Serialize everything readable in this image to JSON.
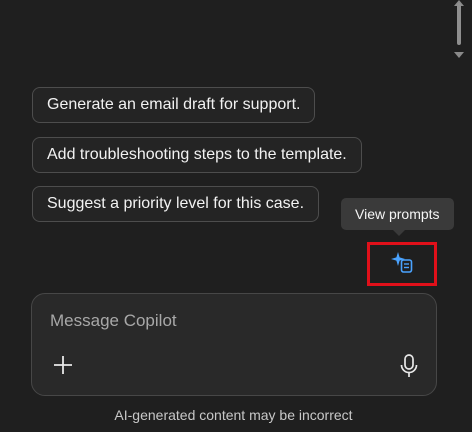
{
  "suggestions": [
    {
      "label": "Generate an email draft for support."
    },
    {
      "label": "Add troubleshooting steps to the template."
    },
    {
      "label": "Suggest a priority level for this case."
    }
  ],
  "tooltip": {
    "text": "View prompts"
  },
  "view_prompts_button": {
    "icon": "sparkle-prompt-icon",
    "highlight_color": "#e0101a",
    "icon_color": "#4aa3ff"
  },
  "composer": {
    "placeholder": "Message Copilot",
    "value": "",
    "attach_icon": "plus-icon",
    "mic_icon": "microphone-icon"
  },
  "footer": {
    "disclaimer": "AI-generated content may be incorrect"
  }
}
